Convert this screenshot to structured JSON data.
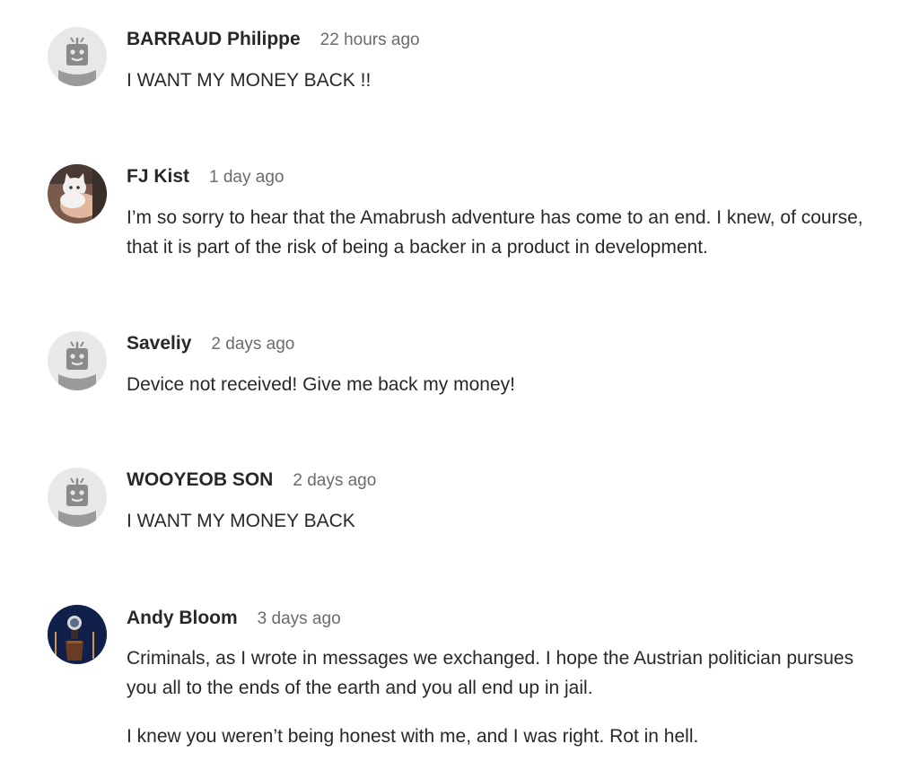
{
  "comments": [
    {
      "author": "BARRAUD Philippe",
      "time": "22 hours ago",
      "avatar": "robot-default-icon",
      "paragraphs": [
        "I WANT MY MONEY BACK !!"
      ]
    },
    {
      "author": "FJ Kist",
      "time": "1 day ago",
      "avatar": "cat-photo-avatar",
      "paragraphs": [
        "I’m so sorry to hear that the Amabrush adventure has come to an end. I knew, of course, that it is part of the risk of being a backer in a product in development."
      ]
    },
    {
      "author": "Saveliy",
      "time": "2 days ago",
      "avatar": "robot-default-icon",
      "paragraphs": [
        "Device not received! Give me back my money!"
      ]
    },
    {
      "author": "WOOYEOB SON",
      "time": "2 days ago",
      "avatar": "robot-default-icon",
      "paragraphs": [
        "I WANT MY MONEY BACK"
      ]
    },
    {
      "author": "Andy Bloom",
      "time": "3 days ago",
      "avatar": "podium-photo-avatar",
      "paragraphs": [
        "Criminals, as I wrote in messages we exchanged. I hope the Austrian politician pursues you all to the ends of the earth and you all end up in jail.",
        "I knew you weren’t being honest with me, and I was right. Rot in hell."
      ]
    }
  ],
  "colors": {
    "author": "#282828",
    "timestamp": "#6b6b6b",
    "body_text": "#282828",
    "robot_avatar_bg": "#e8e8e8",
    "robot_avatar_fg": "#8a8a8a"
  }
}
